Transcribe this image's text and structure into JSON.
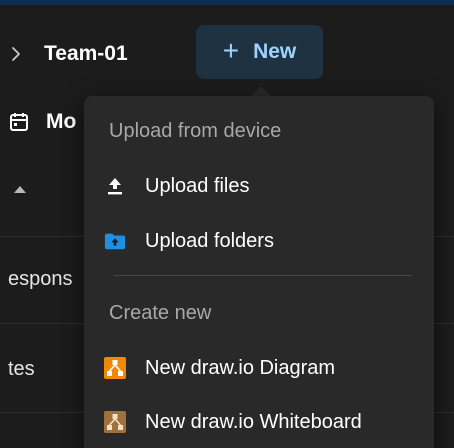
{
  "breadcrumb": {
    "team_name": "Team-01"
  },
  "new_button": {
    "label": "New"
  },
  "header": {
    "title_partial": "Mo"
  },
  "file_rows": [
    {
      "text_partial": "espons"
    },
    {
      "text_partial": "tes"
    }
  ],
  "menu": {
    "section_upload": "Upload from device",
    "section_create": "Create new",
    "items": [
      {
        "label": "Upload files",
        "icon": "upload-icon"
      },
      {
        "label": "Upload folders",
        "icon": "folder-upload-icon"
      },
      {
        "label": "New draw.io Diagram",
        "icon": "drawio-diagram-icon"
      },
      {
        "label": "New draw.io Whiteboard",
        "icon": "drawio-whiteboard-icon"
      }
    ]
  },
  "colors": {
    "background": "#1c1c1c",
    "menu_background": "#292929",
    "accent_text": "#9fd2ff",
    "new_button_bg": "#1e3242",
    "folder_blue": "#1f8fe0",
    "drawio_orange": "#f08705",
    "whiteboard_brown": "#a0713b"
  }
}
